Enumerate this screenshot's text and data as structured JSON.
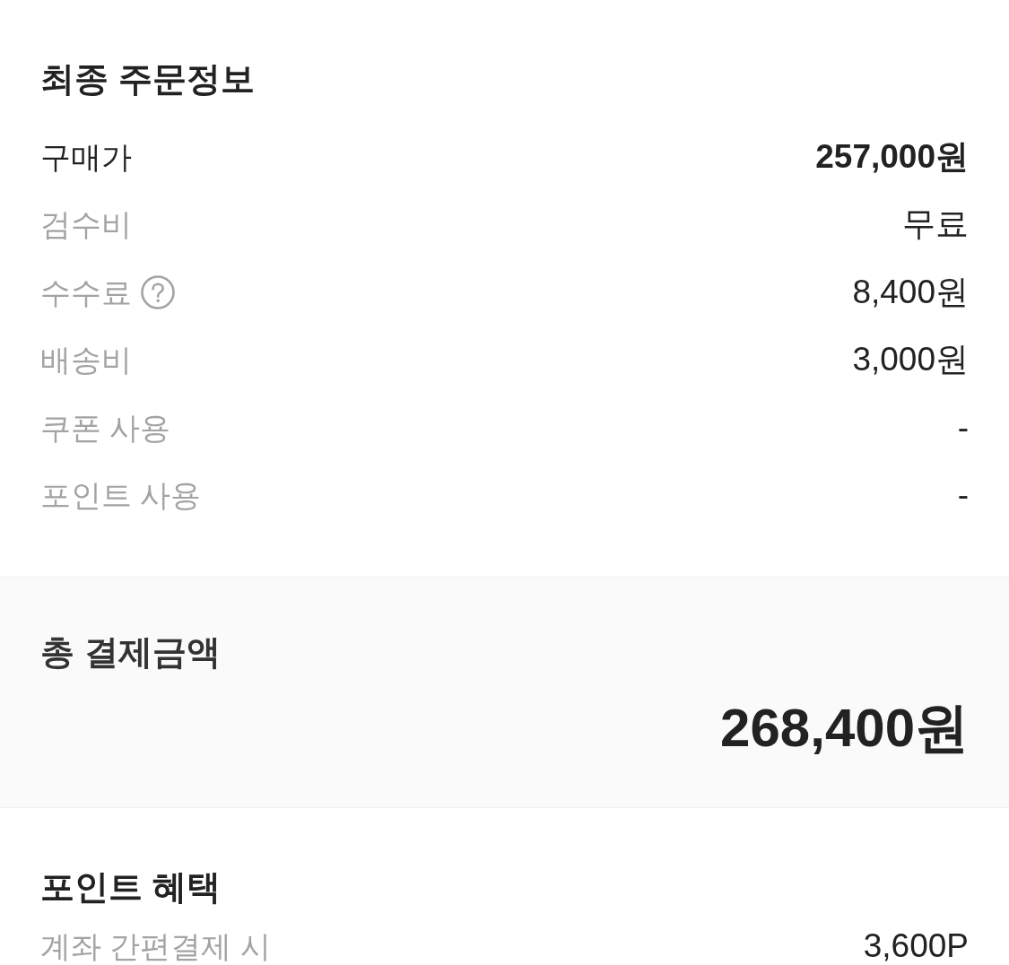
{
  "order_info": {
    "title": "최종 주문정보",
    "rows": [
      {
        "label": "구매가",
        "value": "257,000원",
        "emphasis": true,
        "help": false
      },
      {
        "label": "검수비",
        "value": "무료",
        "emphasis": false,
        "help": false
      },
      {
        "label": "수수료",
        "value": "8,400원",
        "emphasis": false,
        "help": true
      },
      {
        "label": "배송비",
        "value": "3,000원",
        "emphasis": false,
        "help": false
      },
      {
        "label": "쿠폰 사용",
        "value": "-",
        "emphasis": false,
        "help": false
      },
      {
        "label": "포인트 사용",
        "value": "-",
        "emphasis": false,
        "help": false
      }
    ]
  },
  "total": {
    "title": "총 결제금액",
    "amount": "268,400원"
  },
  "point_benefits": {
    "title": "포인트 혜택",
    "rows": [
      {
        "label": "계좌 간편결제 시",
        "value": "3,600P",
        "emphasis": false,
        "help": false
      }
    ]
  }
}
